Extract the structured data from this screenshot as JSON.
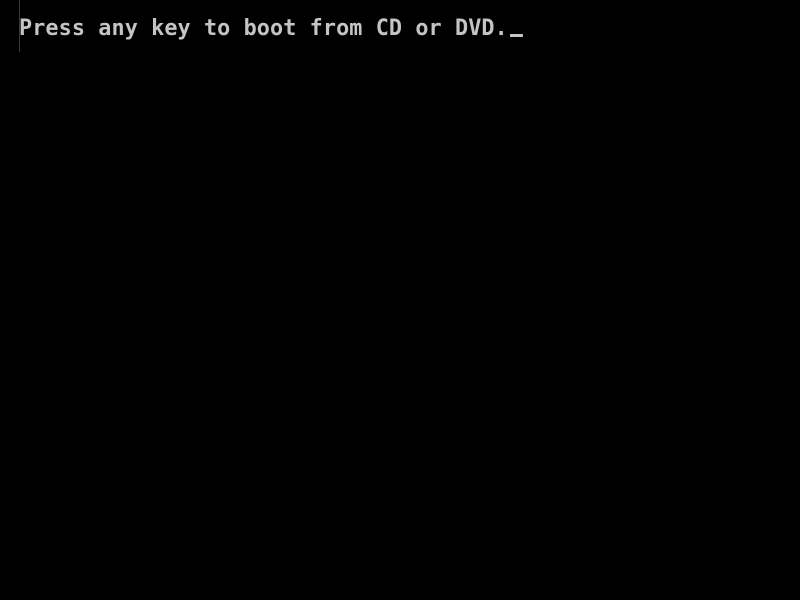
{
  "screen": {
    "background_color": "#000000",
    "text_color": "#c4c4c4",
    "prompt": "Press any key to boot from CD or DVD.",
    "cursor": "text-cursor-underscore"
  }
}
